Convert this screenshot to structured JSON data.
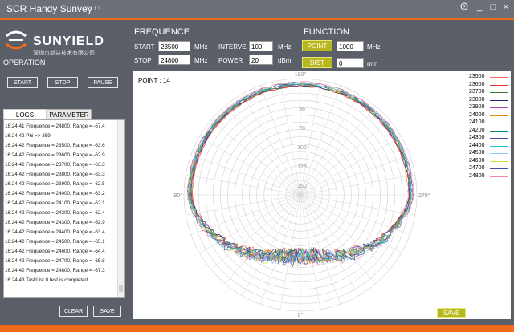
{
  "app": {
    "title": "SCR Handy Sunvey",
    "version": "V2.1.3"
  },
  "window": {
    "help": "?",
    "minimize": "_",
    "maximize": "□",
    "close": "×"
  },
  "brand": {
    "name": "SUNYIELD",
    "subtitle": "深圳市新益技术有限公司"
  },
  "operation": {
    "label": "OPERATION",
    "start": "START",
    "stop": "STOP",
    "pause": "PAUSE"
  },
  "tabs": {
    "logs": "LOGS",
    "parameter": "PARAMETER"
  },
  "logs": [
    "16:24:41 Frequence = 24800, Range = -67.4",
    "16:24:42 Phi => 359",
    "16:24:42 Frequence = 23500, Range = -63.6",
    "16:24:42 Frequence = 23600, Range = -62.9",
    "16:24:42 Frequence = 23700, Range = -63.3",
    "16:24:42 Frequence = 23800, Range = -63.3",
    "16:24:42 Frequence = 23900, Range = -62.5",
    "16:24:42 Frequence = 24000, Range = -63.2",
    "16:24:42 Frequence = 24100, Range = -62.1",
    "16:24:42 Frequence = 24200, Range = -62.4",
    "16:24:42 Frequence = 24300, Range = -62.9",
    "16:24:42 Frequence = 24400, Range = -63.4",
    "16:24:42 Frequence = 24500, Range = -65.1",
    "16:24:42 Frequence = 24600, Range = -64.4",
    "16:24:42 Frequence = 24700, Range = -65.8",
    "16:24:42 Frequence = 24800, Range = -67.3",
    "16:24:43 TaskList 0 test is completed"
  ],
  "log_actions": {
    "clear": "CLEAR",
    "save": "SAVE"
  },
  "frequence": {
    "label": "FREQUENCE",
    "start_label": "START",
    "start_value": "23500",
    "start_unit": "MHz",
    "stop_label": "STOP",
    "stop_value": "24800",
    "stop_unit": "MHz",
    "interval_label": "INTERVEI",
    "interval_value": "100",
    "interval_unit": "MHz",
    "power_label": "POWER",
    "power_value": "20",
    "power_unit": "dBm"
  },
  "function": {
    "label": "FUNCTION",
    "point_button": "POINT",
    "point_value": "1000",
    "point_unit": "MHz",
    "dist_button": "DIST",
    "dist_value": "0",
    "dist_unit": "mm"
  },
  "plot": {
    "point_label": "POINT : 14",
    "angle_labels": {
      "top": "180°",
      "left": "90°",
      "right": "270°",
      "bottom": "0°"
    },
    "ring_labels": [
      "56",
      "78",
      "102",
      "126",
      "150"
    ],
    "save_button": "SAVE",
    "accent": "#b8b81e"
  },
  "chart_data": {
    "type": "scatter",
    "series": [
      {
        "name": "23500",
        "color": "#ff6b6b"
      },
      {
        "name": "23600",
        "color": "#e53935"
      },
      {
        "name": "23700",
        "color": "#2e7d32"
      },
      {
        "name": "23800",
        "color": "#1a237e"
      },
      {
        "name": "23900",
        "color": "#ab47bc"
      },
      {
        "name": "24000",
        "color": "#e08a00"
      },
      {
        "name": "24100",
        "color": "#4caf50"
      },
      {
        "name": "24200",
        "color": "#00897b"
      },
      {
        "name": "24300",
        "color": "#3949ab"
      },
      {
        "name": "24400",
        "color": "#26c6da"
      },
      {
        "name": "24500",
        "color": "#90caf9"
      },
      {
        "name": "24600",
        "color": "#cddc39"
      },
      {
        "name": "24700",
        "color": "#3f51b5"
      },
      {
        "name": "24800",
        "color": "#ff80ab"
      }
    ]
  }
}
